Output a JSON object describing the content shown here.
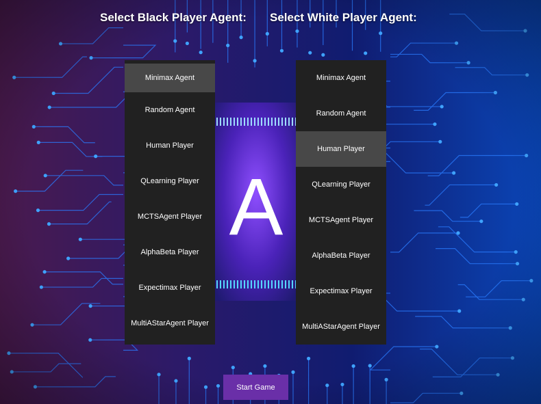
{
  "headings": {
    "black": "Select Black Player Agent:",
    "white": "Select White Player Agent:"
  },
  "chip_letter": "A",
  "black_agents": {
    "selected": "Minimax Agent",
    "options": [
      "Minimax Agent",
      "Random Agent",
      "Human Player",
      "QLearning Player",
      "MCTSAgent Player",
      "AlphaBeta Player",
      "Expectimax Player",
      "MultiAStarAgent Player"
    ]
  },
  "white_agents": {
    "selected": "Human Player",
    "options": [
      "Minimax Agent",
      "Random Agent",
      "Human Player",
      "QLearning Player",
      "MCTSAgent Player",
      "AlphaBeta Player",
      "Expectimax Player",
      "MultiAStarAgent Player"
    ]
  },
  "start_button": "Start Game",
  "colors": {
    "panel_bg": "#212121",
    "selected_bg": "#484848",
    "button_bg": "#6a2fa8",
    "circuit_left": "#4a1a5e",
    "circuit_right": "#0a3a9a",
    "trace": "#2a8bff"
  }
}
